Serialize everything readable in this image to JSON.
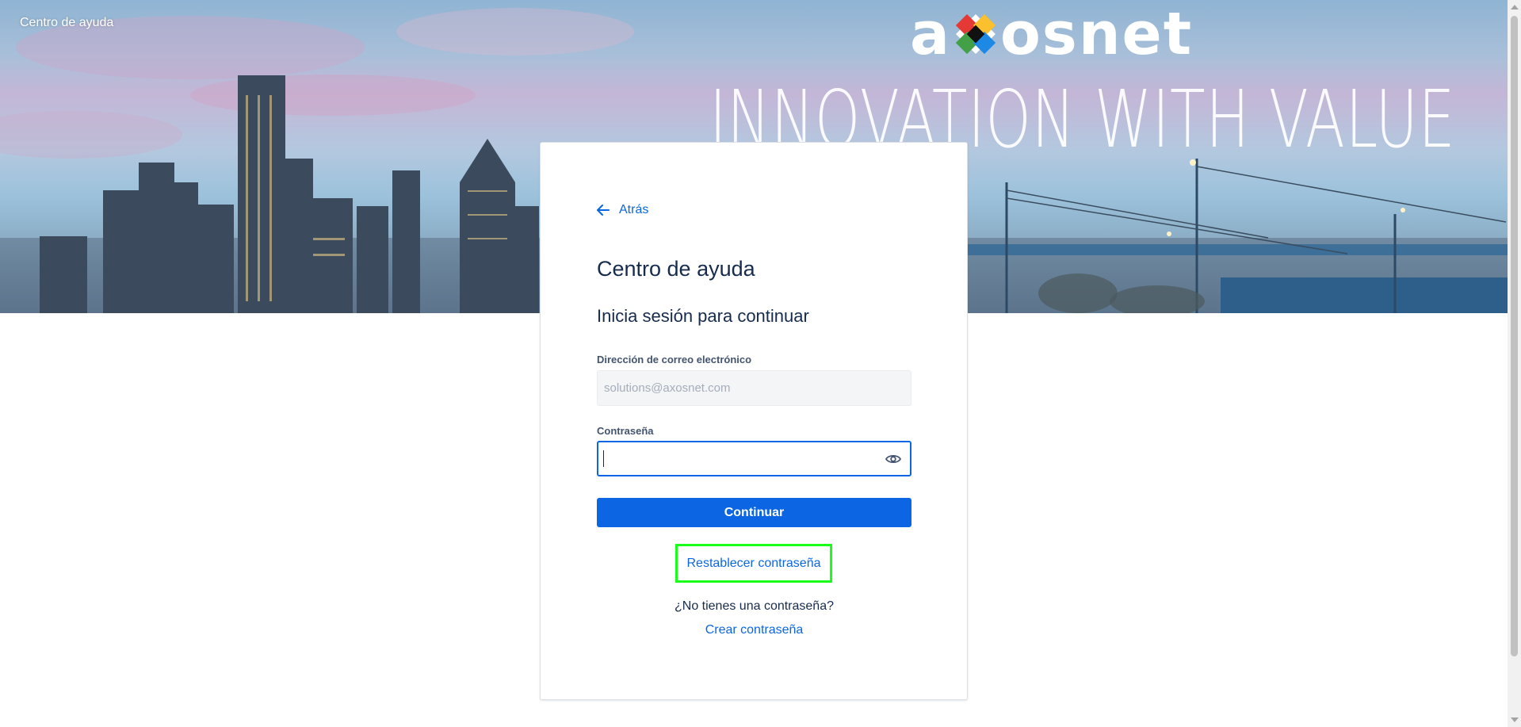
{
  "header": {
    "help_center": "Centro de ayuda"
  },
  "banner": {
    "brand_left": "a",
    "brand_right": "osnet",
    "tagline": "INNOVATION WITH VALUE"
  },
  "card": {
    "back_label": "Atrás",
    "title": "Centro de ayuda",
    "subtitle": "Inicia sesión para continuar",
    "email_label": "Dirección de correo electrónico",
    "email_placeholder": "solutions@axosnet.com",
    "password_label": "Contraseña",
    "password_value": "",
    "continue_label": "Continuar",
    "reset_label": "Restablecer contraseña",
    "no_password_text": "¿No tienes una contraseña?",
    "create_label": "Crear contraseña"
  },
  "colors": {
    "accent": "#0c66e4",
    "highlight": "#19ff19",
    "text": "#172b4d"
  },
  "icons": {
    "back": "arrow-left-icon",
    "show_password": "eye-icon",
    "logo": "axosnet-logo-icon"
  }
}
